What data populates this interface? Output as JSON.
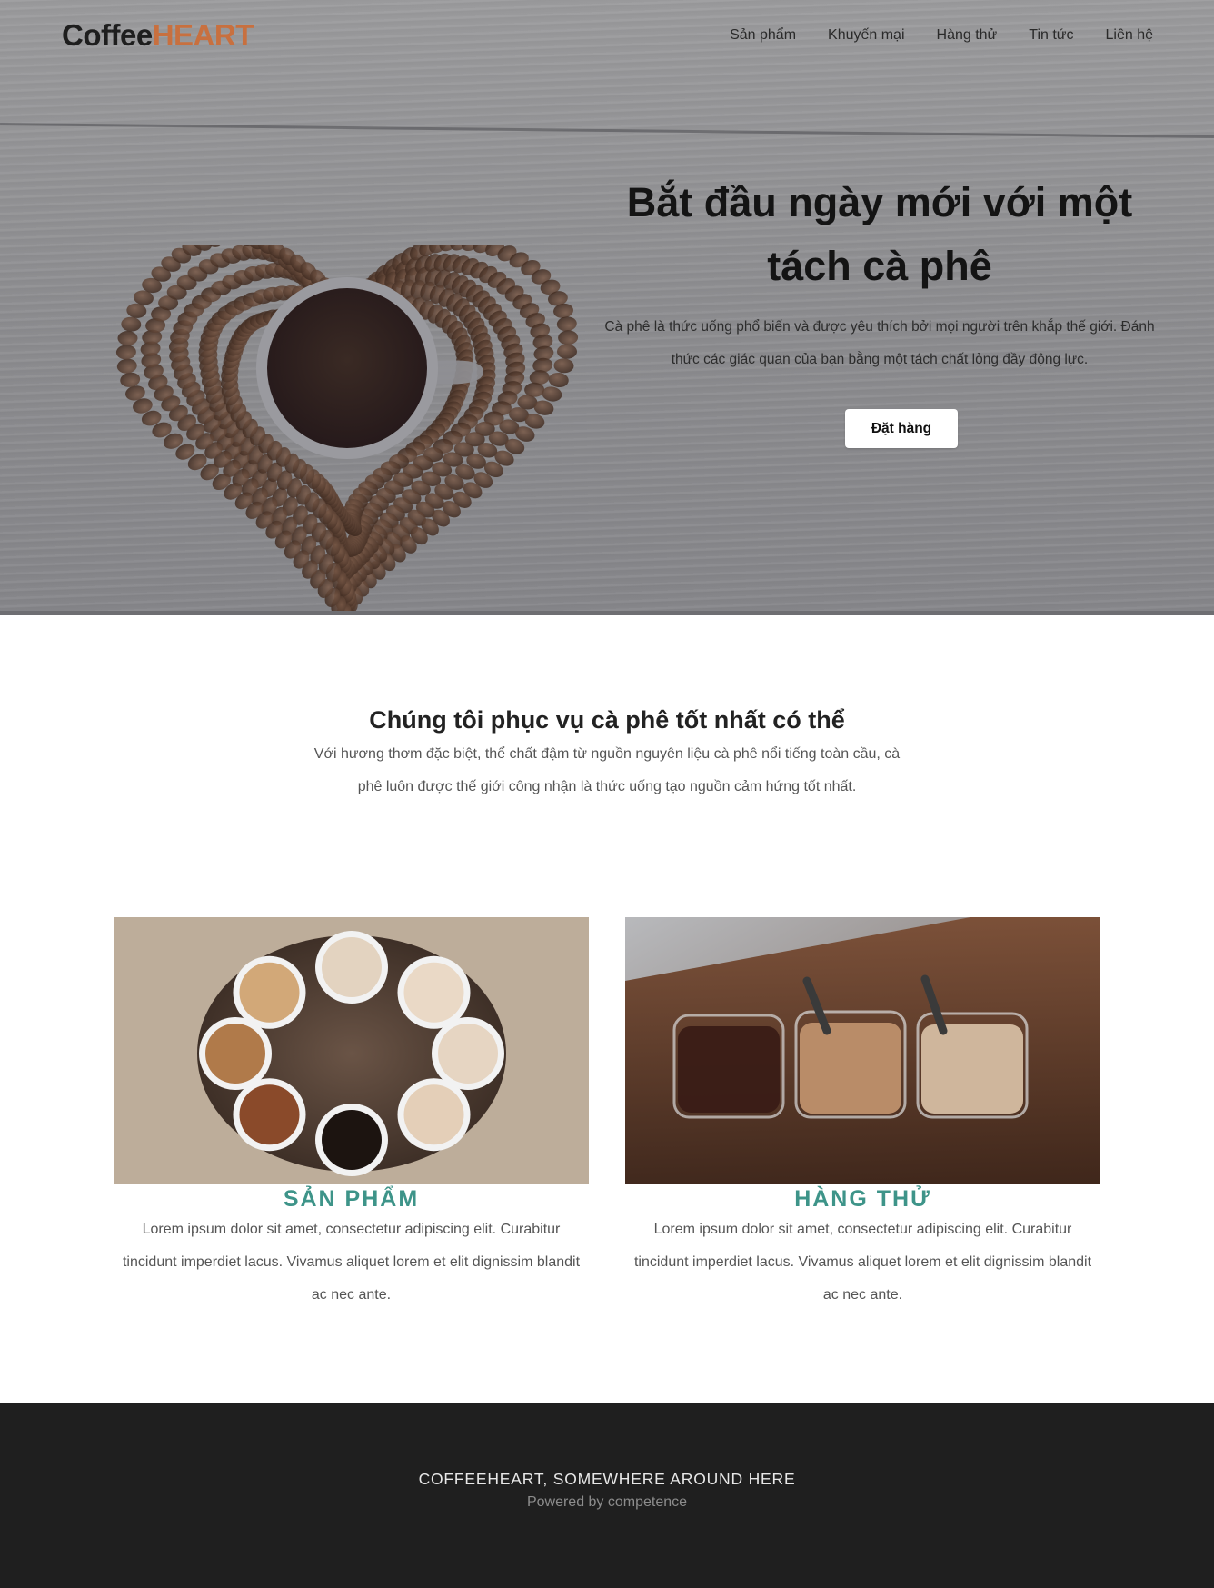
{
  "header": {
    "logo_part1": "Coffee",
    "logo_part2": "HEART",
    "nav": [
      "Sản phẩm",
      "Khuyến mại",
      "Hàng thử",
      "Tin tức",
      "Liên hệ"
    ]
  },
  "hero": {
    "title": "Bắt đầu ngày mới với một tách cà phê",
    "text": "Cà phê là thức uống phổ biến và được yêu thích bởi mọi người trên khắp thế giới. Đánh thức các giác quan của bạn bằng một tách chất lỏng đầy động lực.",
    "button": "Đặt hàng"
  },
  "intro": {
    "title": "Chúng tôi phục vụ cà phê tốt nhất có thể",
    "text": "Với hương thơm đặc biệt, thể chất đậm từ nguồn nguyên liệu cà phê nổi tiếng toàn cầu, cà phê luôn được thế giới công nhận là thức uống tạo nguồn cảm hứng tốt nhất."
  },
  "cards": [
    {
      "title": "SẢN PHẨM",
      "text": "Lorem ipsum dolor sit amet, consectetur adipiscing elit. Curabitur tincidunt imperdiet lacus. Vivamus aliquet lorem et elit dignissim blandit ac nec ante."
    },
    {
      "title": "HÀNG THỬ",
      "text": "Lorem ipsum dolor sit amet, consectetur adipiscing elit. Curabitur tincidunt imperdiet lacus. Vivamus aliquet lorem et elit dignissim blandit ac nec ante."
    }
  ],
  "footer": {
    "title": "COFFEEHEART, SOMEWHERE AROUND HERE",
    "subtitle": "Powered by competence"
  },
  "colors": {
    "logo_accent": "#c8703f",
    "card_title": "#3e9489",
    "footer_bg": "#1f1f1f"
  },
  "icons": [
    "coffee-beans-heart-image",
    "coffee-cups-table-image",
    "coffee-glasses-image"
  ]
}
